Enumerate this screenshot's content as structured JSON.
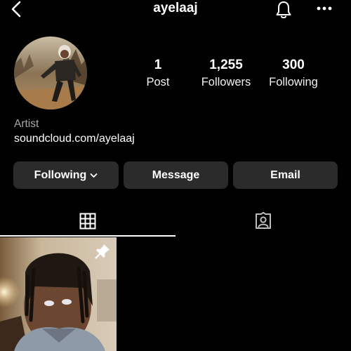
{
  "header": {
    "username": "ayelaaj",
    "back_icon": "chevron-left-icon",
    "bell_icon": "bell-icon",
    "more_icon": "more-horizontal-icon"
  },
  "profile": {
    "stats": {
      "posts": {
        "value": "1",
        "label": "Post"
      },
      "followers": {
        "value": "1,255",
        "label": "Followers"
      },
      "following": {
        "value": "300",
        "label": "Following"
      }
    },
    "bio": {
      "category": "Artist",
      "link": "soundcloud.com/ayelaaj"
    }
  },
  "actions": {
    "following_label": "Following",
    "message_label": "Message",
    "email_label": "Email"
  },
  "tabs": {
    "grid_icon": "grid-icon",
    "tagged_icon": "tagged-person-icon",
    "active": "grid"
  },
  "posts": [
    {
      "pinned": true,
      "pin_icon": "pin-icon"
    }
  ],
  "colors": {
    "background": "#000000",
    "button_bg": "#2b2b2b",
    "secondary_text": "#a8a8a8",
    "text": "#ffffff"
  }
}
